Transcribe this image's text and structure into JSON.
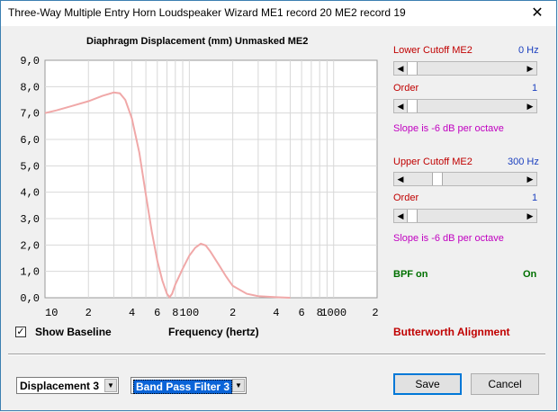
{
  "window": {
    "title": "Three-Way Multiple Entry Horn Loudspeaker Wizard   ME1 record 20    ME2 record 19",
    "close_glyph": "✕"
  },
  "chart": {
    "title": "Diaphragm Displacement (mm)   Unmasked    ME2",
    "x_axis_label": "Frequency (hertz)",
    "y_tick_labels": [
      "9,0",
      "8,0",
      "7,0",
      "6,0",
      "5,0",
      "4,0",
      "3,0",
      "2,0",
      "1,0",
      "0,0"
    ],
    "x_tick_labels": [
      "10",
      "2",
      "4",
      "6",
      "8",
      "100",
      "2",
      "4",
      "6",
      "8",
      "1000",
      "2"
    ]
  },
  "chart_data": {
    "type": "line",
    "title": "Diaphragm Displacement (mm)   Unmasked    ME2",
    "xlabel": "Frequency (hertz)",
    "ylabel": "",
    "x_scale": "log",
    "xlim": [
      10,
      2000
    ],
    "ylim": [
      0,
      9
    ],
    "grid": true,
    "series": [
      {
        "color": "#f0a8a8",
        "points": [
          [
            10,
            7.0
          ],
          [
            12,
            7.1
          ],
          [
            15,
            7.25
          ],
          [
            20,
            7.45
          ],
          [
            25,
            7.65
          ],
          [
            30,
            7.78
          ],
          [
            33,
            7.75
          ],
          [
            36,
            7.5
          ],
          [
            40,
            6.8
          ],
          [
            45,
            5.5
          ],
          [
            50,
            3.9
          ],
          [
            55,
            2.5
          ],
          [
            60,
            1.4
          ],
          [
            65,
            0.65
          ],
          [
            70,
            0.15
          ],
          [
            73,
            0.02
          ],
          [
            76,
            0.15
          ],
          [
            80,
            0.5
          ],
          [
            90,
            1.1
          ],
          [
            100,
            1.6
          ],
          [
            110,
            1.9
          ],
          [
            120,
            2.05
          ],
          [
            130,
            1.98
          ],
          [
            140,
            1.75
          ],
          [
            160,
            1.25
          ],
          [
            180,
            0.8
          ],
          [
            200,
            0.45
          ],
          [
            250,
            0.15
          ],
          [
            300,
            0.06
          ],
          [
            400,
            0.02
          ],
          [
            500,
            0.0
          ]
        ]
      }
    ]
  },
  "right_panel": {
    "lower_cutoff_label": "Lower Cutoff  ME2",
    "lower_cutoff_value": "0 Hz",
    "lower_order_label": "Order",
    "lower_order_value": "1",
    "lower_slope_text": "Slope is -6 dB per octave",
    "upper_cutoff_label": "Upper Cutoff  ME2",
    "upper_cutoff_value": "300 Hz",
    "upper_order_label": "Order",
    "upper_order_value": "1",
    "upper_slope_text": "Slope is -6 dB per octave",
    "bpf_label": "BPF on",
    "bpf_value": "On",
    "alignment_text": "Butterworth Alignment",
    "slider_levels": {
      "lower_cutoff": 0.0,
      "lower_order": 0.0,
      "upper_cutoff": 0.24,
      "upper_order": 0.0
    }
  },
  "options": {
    "show_baseline_label": "Show Baseline",
    "show_baseline_checked": true,
    "check_glyph": "✓"
  },
  "footer": {
    "displacement_select": "Displacement 3",
    "filter_select": "Band Pass Filter 3",
    "save_label": "Save",
    "cancel_label": "Cancel",
    "dropdown_glyph": "▼"
  },
  "glyphs": {
    "left_arrow": "◀",
    "right_arrow": "▶"
  }
}
